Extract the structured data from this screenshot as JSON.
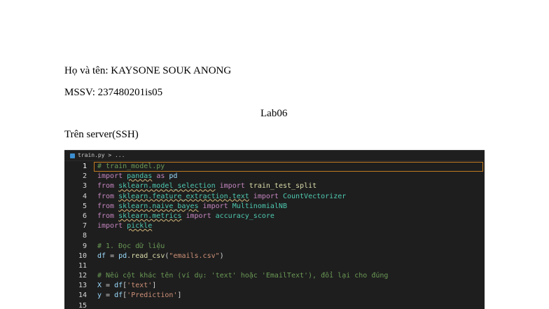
{
  "document": {
    "name_line": "Họ và tên: KAYSONE SOUK ANONG",
    "mssv_line": "MSSV: 237480201is05",
    "title": "Lab06",
    "server_line": "Trên server(SSH)"
  },
  "editor": {
    "breadcrumb": "train.py > ...",
    "active_line": 1,
    "lines": [
      {
        "n": "1",
        "text": "# train_model.py"
      },
      {
        "n": "2",
        "text": "import pandas as pd"
      },
      {
        "n": "3",
        "text": "from sklearn.model_selection import train_test_split"
      },
      {
        "n": "4",
        "text": "from sklearn.feature_extraction.text import CountVectorizer"
      },
      {
        "n": "5",
        "text": "from sklearn.naive_bayes import MultinomialNB"
      },
      {
        "n": "6",
        "text": "from sklearn.metrics import accuracy_score"
      },
      {
        "n": "7",
        "text": "import pickle"
      },
      {
        "n": "8",
        "text": ""
      },
      {
        "n": "9",
        "text": "# 1. Đọc dữ liệu"
      },
      {
        "n": "10",
        "text": "df = pd.read_csv(\"emails.csv\")"
      },
      {
        "n": "11",
        "text": ""
      },
      {
        "n": "12",
        "text": "# Nếu cột khác tên (ví dụ: 'text' hoặc 'EmailText'), đổi lại cho đúng"
      },
      {
        "n": "13",
        "text": "X = df['text']"
      },
      {
        "n": "14",
        "text": "y = df['Prediction']"
      },
      {
        "n": "15",
        "text": ""
      }
    ]
  }
}
